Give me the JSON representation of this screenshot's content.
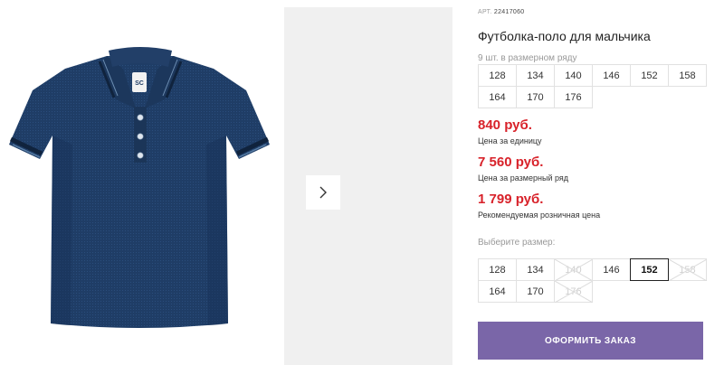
{
  "product": {
    "art_label": "АРТ.",
    "art_number": "22417060",
    "title": "Футболка-поло для мальчика",
    "row_count_text": "9 шт. в размерном ряду"
  },
  "size_row": [
    "128",
    "134",
    "140",
    "146",
    "152",
    "158",
    "164",
    "170",
    "176"
  ],
  "prices": [
    {
      "value": "840 руб.",
      "note": "Цена за единицу"
    },
    {
      "value": "7 560 руб.",
      "note": "Цена за размерный ряд"
    },
    {
      "value": "1 799 руб.",
      "note": "Рекомендуемая розничная цена"
    }
  ],
  "choose_label": "Выберите размер:",
  "size_options": [
    {
      "label": "128",
      "state": "available"
    },
    {
      "label": "134",
      "state": "available"
    },
    {
      "label": "140",
      "state": "unavailable"
    },
    {
      "label": "146",
      "state": "available"
    },
    {
      "label": "152",
      "state": "selected"
    },
    {
      "label": "158",
      "state": "unavailable"
    },
    {
      "label": "164",
      "state": "available"
    },
    {
      "label": "170",
      "state": "available"
    },
    {
      "label": "176",
      "state": "unavailable"
    }
  ],
  "order_button": "ОФОРМИТЬ ЗАКАЗ",
  "colors": {
    "price_red": "#d8222a",
    "order_purple": "#7a66a8",
    "shirt_navy": "#1f3d66"
  },
  "icons": {
    "next": "chevron-right-icon"
  }
}
